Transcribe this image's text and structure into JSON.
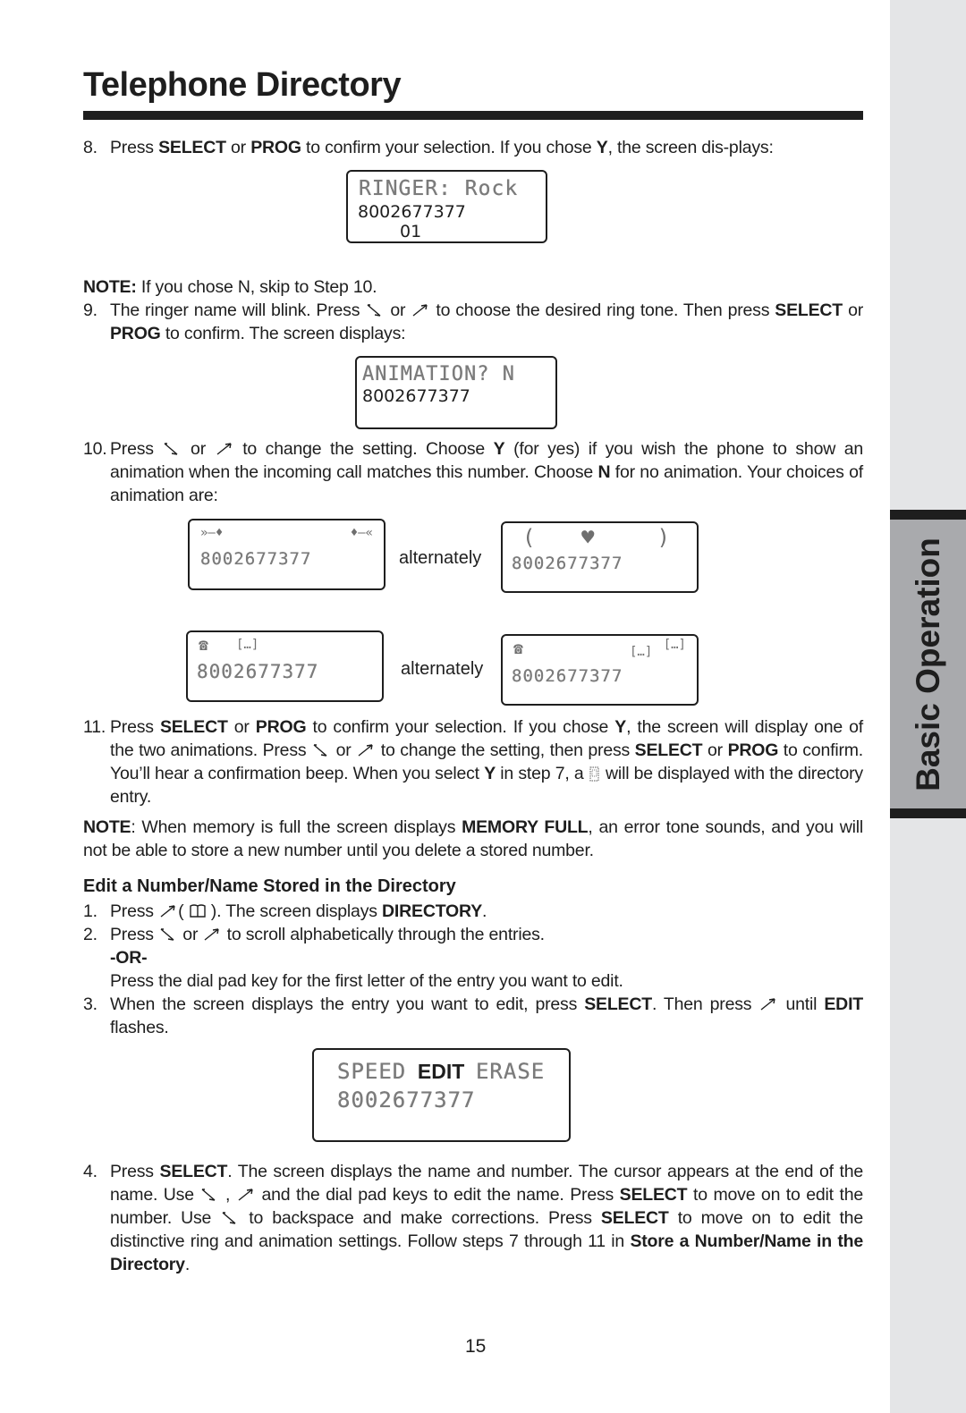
{
  "page": {
    "title": "Telephone Directory",
    "side_tab": "Basic Operation",
    "page_number": "15"
  },
  "icons": {
    "down_arrow": "down-left-arrow-key",
    "up_arrow": "up-right-arrow-key",
    "book": "directory-book-key",
    "animation_flag": "animation-indicator"
  },
  "step8": {
    "num": "8.",
    "t1": "Press ",
    "b1": "SELECT",
    "t2": " or ",
    "b2": "PROG",
    "t3": " to confirm your selection.  If you chose ",
    "b3": "Y",
    "t4": ", the screen dis-plays:"
  },
  "lcd_ringer": {
    "line1": "RINGER: Rock",
    "line2": "8002677377",
    "line3": "01"
  },
  "note1": {
    "label": "NOTE:",
    "text": " If you chose N, skip to Step 10."
  },
  "step9": {
    "num": "9.",
    "t1": "The ringer name will blink.  Press ",
    "t2": " or ",
    "t3": " to choose the desired ring tone.  Then press ",
    "b1": "SELECT",
    "t4": " or ",
    "b2": "PROG",
    "t5": " to confirm. The screen displays:"
  },
  "lcd_animation": {
    "line1": "ANIMATION? N",
    "line2": "8002677377"
  },
  "step10": {
    "num": "10.",
    "t1": "Press ",
    "t2": " or ",
    "t3": " to change the setting.  Choose ",
    "b1": "Y",
    "t4": " (for yes) if you wish the phone to show an animation when the incoming call matches this number. Choose ",
    "b2": "N",
    "t5": " for no animation. Your choices of animation are:"
  },
  "animations": [
    {
      "frame_a": {
        "icons_left": "»—♦",
        "icons_right": "♦—«",
        "number": "8002677377"
      },
      "separator": "alternately",
      "frame_b": {
        "icons_left": "(",
        "icons_mid": "♥",
        "icons_right": ")",
        "number": "8002677377"
      }
    },
    {
      "frame_a": {
        "icons_left": "☎",
        "icons_mid": "[…]",
        "number": "8002677377"
      },
      "separator": "alternately",
      "frame_b": {
        "icons_left": "☎",
        "icons_mid": "[…]",
        "icons_right": "[…]",
        "number": "8002677377"
      }
    }
  ],
  "step11": {
    "num": "11.",
    "t1": "Press ",
    "b1": "SELECT",
    "t2": " or ",
    "b2": "PROG",
    "t3": " to confirm your selection.  If you chose ",
    "b3": "Y",
    "t4": ", the screen will display one of the two animations. Press ",
    "t5": " or ",
    "t6": " to change the setting, then press ",
    "b4": "SELECT",
    "t7": " or ",
    "b5": "PROG",
    "t8": " to confirm. You’ll hear a confirmation beep. When you select ",
    "b6": "Y",
    "t9": " in step 7, a ",
    "t10": " will be displayed with the directory entry."
  },
  "note2": {
    "label": "NOTE",
    "t1": ": When memory is full the screen displays ",
    "b1": "MEMORY FULL",
    "t2": ", an error tone sounds, and you will not be able to store a new number until you delete a stored number."
  },
  "section_heading": "Edit a Number/Name Stored in the Directory",
  "edit_step1": {
    "num": "1.",
    "t1": "Press ",
    "t2": "( ",
    "t3": " ). The screen displays ",
    "b1": "DIRECTORY",
    "t4": "."
  },
  "edit_step2": {
    "num": "2.",
    "t1": "Press ",
    "t2": " or ",
    "t3": " to scroll alphabetically through the entries.",
    "or": "-OR-",
    "alt": "Press the dial pad key for the first letter of the entry you want to edit."
  },
  "edit_step3": {
    "num": "3.",
    "t1": "When the screen displays the entry you want to edit, press ",
    "b1": "SELECT",
    "t2": ". Then press ",
    "t3": " until ",
    "b2": "EDIT",
    "t4": " flashes."
  },
  "lcd_edit": {
    "opt1": "SPEED",
    "opt2": "EDIT",
    "opt3": "ERASE",
    "number": "8002677377"
  },
  "edit_step4": {
    "num": "4.",
    "t1": "Press ",
    "b1": "SELECT",
    "t2": ". The screen displays the name and number. The cursor appears at the end of the name. Use ",
    "t3": " , ",
    "t4": " and the dial pad keys to edit the name. Press ",
    "b2": "SELECT",
    "t5": " to move on to edit the number. Use ",
    "t6": " to backspace and make corrections. Press ",
    "b3": "SELECT",
    "t7": " to move on to edit the distinctive ring and animation settings. Follow steps 7 through 11 in ",
    "b4": "Store a Number/Name in the Directory",
    "t8": "."
  }
}
